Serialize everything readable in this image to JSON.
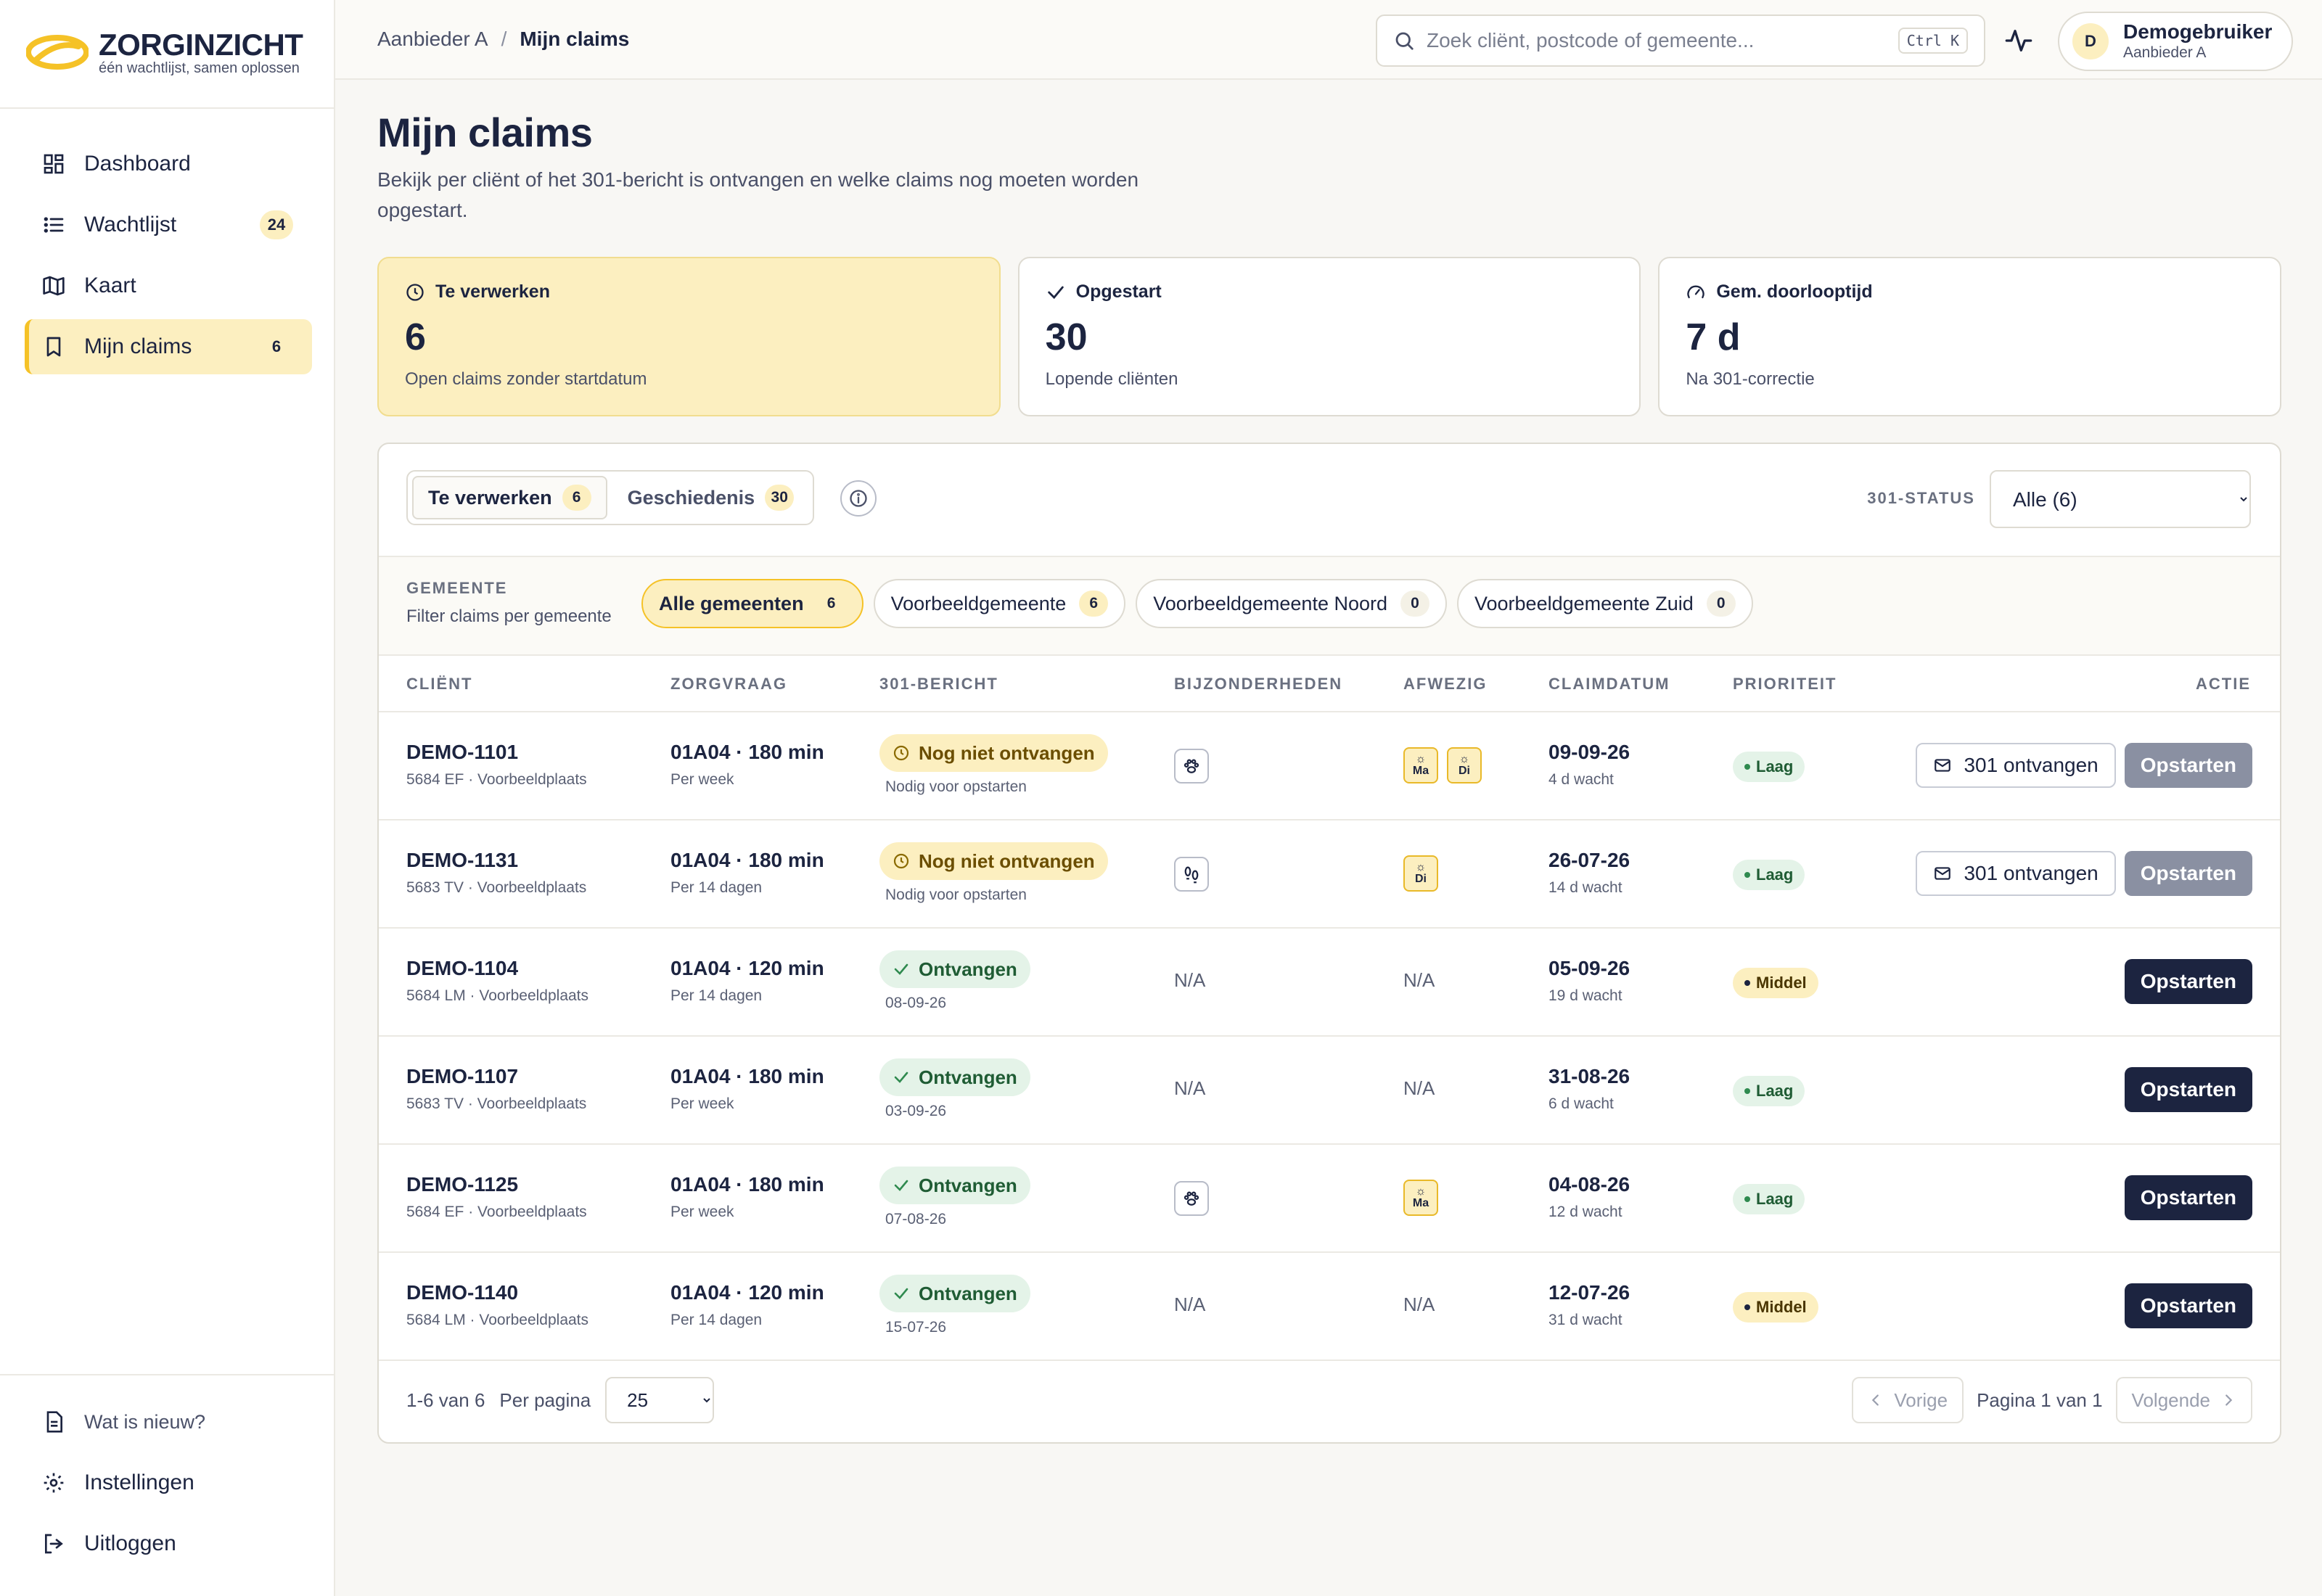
{
  "brand": {
    "name": "ZORGINZICHT",
    "tagline": "één wachtlijst, samen oplossen",
    "accent": "#f5c227",
    "navy": "#1c2440"
  },
  "sidebar": {
    "items": [
      {
        "label": "Dashboard",
        "icon": "dashboard-icon",
        "count": null
      },
      {
        "label": "Wachtlijst",
        "icon": "list-icon",
        "count": "24"
      },
      {
        "label": "Kaart",
        "icon": "map-icon",
        "count": null
      },
      {
        "label": "Mijn claims",
        "icon": "bookmark-icon",
        "count": "6",
        "active": true
      }
    ],
    "bottom": [
      {
        "label": "Wat is nieuw?",
        "icon": "document-icon"
      },
      {
        "label": "Instellingen",
        "icon": "gear-icon"
      },
      {
        "label": "Uitloggen",
        "icon": "logout-icon"
      }
    ]
  },
  "topbar": {
    "breadcrumb": [
      "Aanbieder A",
      "Mijn claims"
    ],
    "search_placeholder": "Zoek cliënt, postcode of gemeente...",
    "shortcut": "Ctrl K",
    "user": {
      "initial": "D",
      "name": "Demogebruiker",
      "org": "Aanbieder A"
    }
  },
  "page": {
    "title": "Mijn claims",
    "subtitle": "Bekijk per cliënt of het 301-bericht is ontvangen en welke claims nog moeten worden opgestart."
  },
  "stats": [
    {
      "label": "Te verwerken",
      "value": "6",
      "sub": "Open claims zonder startdatum",
      "icon": "clock-icon"
    },
    {
      "label": "Opgestart",
      "value": "30",
      "sub": "Lopende cliënten",
      "icon": "check-icon"
    },
    {
      "label": "Gem. doorlooptijd",
      "value": "7 d",
      "sub": "Na 301-correctie",
      "icon": "gauge-icon"
    }
  ],
  "tabs": [
    {
      "label": "Te verwerken",
      "count": "6",
      "active": true
    },
    {
      "label": "Geschiedenis",
      "count": "30",
      "active": false
    }
  ],
  "status_filter": {
    "label": "301-STATUS",
    "value": "Alle (6)"
  },
  "gemeente_filter": {
    "title": "GEMEENTE",
    "sub": "Filter claims per gemeente",
    "chips": [
      {
        "label": "Alle gemeenten",
        "count": "6",
        "active": true
      },
      {
        "label": "Voorbeeldgemeente",
        "count": "6"
      },
      {
        "label": "Voorbeeldgemeente Noord",
        "count": "0"
      },
      {
        "label": "Voorbeeldgemeente Zuid",
        "count": "0"
      }
    ]
  },
  "table": {
    "headers": {
      "client": "CLIËNT",
      "zorgvraag": "ZORGVRAAG",
      "bericht": "301-BERICHT",
      "bijz": "BIJZONDERHEDEN",
      "afwezig": "AFWEZIG",
      "claimdatum": "CLAIMDATUM",
      "prioriteit": "PRIORITEIT",
      "actie": "ACTIE"
    },
    "rows": [
      {
        "id": "DEMO-1101",
        "addr": "5684 EF · Voorbeeldplaats",
        "zorg": "01A04 · 180 min",
        "freq": "Per week",
        "msg": "Nog niet ontvangen",
        "msg_sub": "Nodig voor opstarten",
        "received": false,
        "bijz": "paw",
        "afwezig": [
          "Ma",
          "Di"
        ],
        "date": "09-09-26",
        "wait": "4 d wacht",
        "prio": "Laag"
      },
      {
        "id": "DEMO-1131",
        "addr": "5683 TV · Voorbeeldplaats",
        "zorg": "01A04 · 180 min",
        "freq": "Per 14 dagen",
        "msg": "Nog niet ontvangen",
        "msg_sub": "Nodig voor opstarten",
        "received": false,
        "bijz": "footprints",
        "afwezig": [
          "Di"
        ],
        "date": "26-07-26",
        "wait": "14 d wacht",
        "prio": "Laag"
      },
      {
        "id": "DEMO-1104",
        "addr": "5684 LM · Voorbeeldplaats",
        "zorg": "01A04 · 120 min",
        "freq": "Per 14 dagen",
        "msg": "Ontvangen",
        "msg_sub": "08-09-26",
        "received": true,
        "bijz": null,
        "afwezig": [],
        "date": "05-09-26",
        "wait": "19 d wacht",
        "prio": "Middel"
      },
      {
        "id": "DEMO-1107",
        "addr": "5683 TV · Voorbeeldplaats",
        "zorg": "01A04 · 180 min",
        "freq": "Per week",
        "msg": "Ontvangen",
        "msg_sub": "03-09-26",
        "received": true,
        "bijz": null,
        "afwezig": [],
        "date": "31-08-26",
        "wait": "6 d wacht",
        "prio": "Laag"
      },
      {
        "id": "DEMO-1125",
        "addr": "5684 EF · Voorbeeldplaats",
        "zorg": "01A04 · 180 min",
        "freq": "Per week",
        "msg": "Ontvangen",
        "msg_sub": "07-08-26",
        "received": true,
        "bijz": "paw",
        "afwezig": [
          "Ma"
        ],
        "date": "04-08-26",
        "wait": "12 d wacht",
        "prio": "Laag"
      },
      {
        "id": "DEMO-1140",
        "addr": "5684 LM · Voorbeeldplaats",
        "zorg": "01A04 · 120 min",
        "freq": "Per 14 dagen",
        "msg": "Ontvangen",
        "msg_sub": "15-07-26",
        "received": true,
        "bijz": null,
        "afwezig": [],
        "date": "12-07-26",
        "wait": "31 d wacht",
        "prio": "Middel"
      }
    ],
    "na_label": "N/A",
    "btn_301": "301 ontvangen",
    "btn_start": "Opstarten"
  },
  "pagination": {
    "range": "1-6 van 6",
    "per_page_label": "Per pagina",
    "per_page": "25",
    "prev": "Vorige",
    "page": "Pagina 1 van 1",
    "next": "Volgende"
  }
}
